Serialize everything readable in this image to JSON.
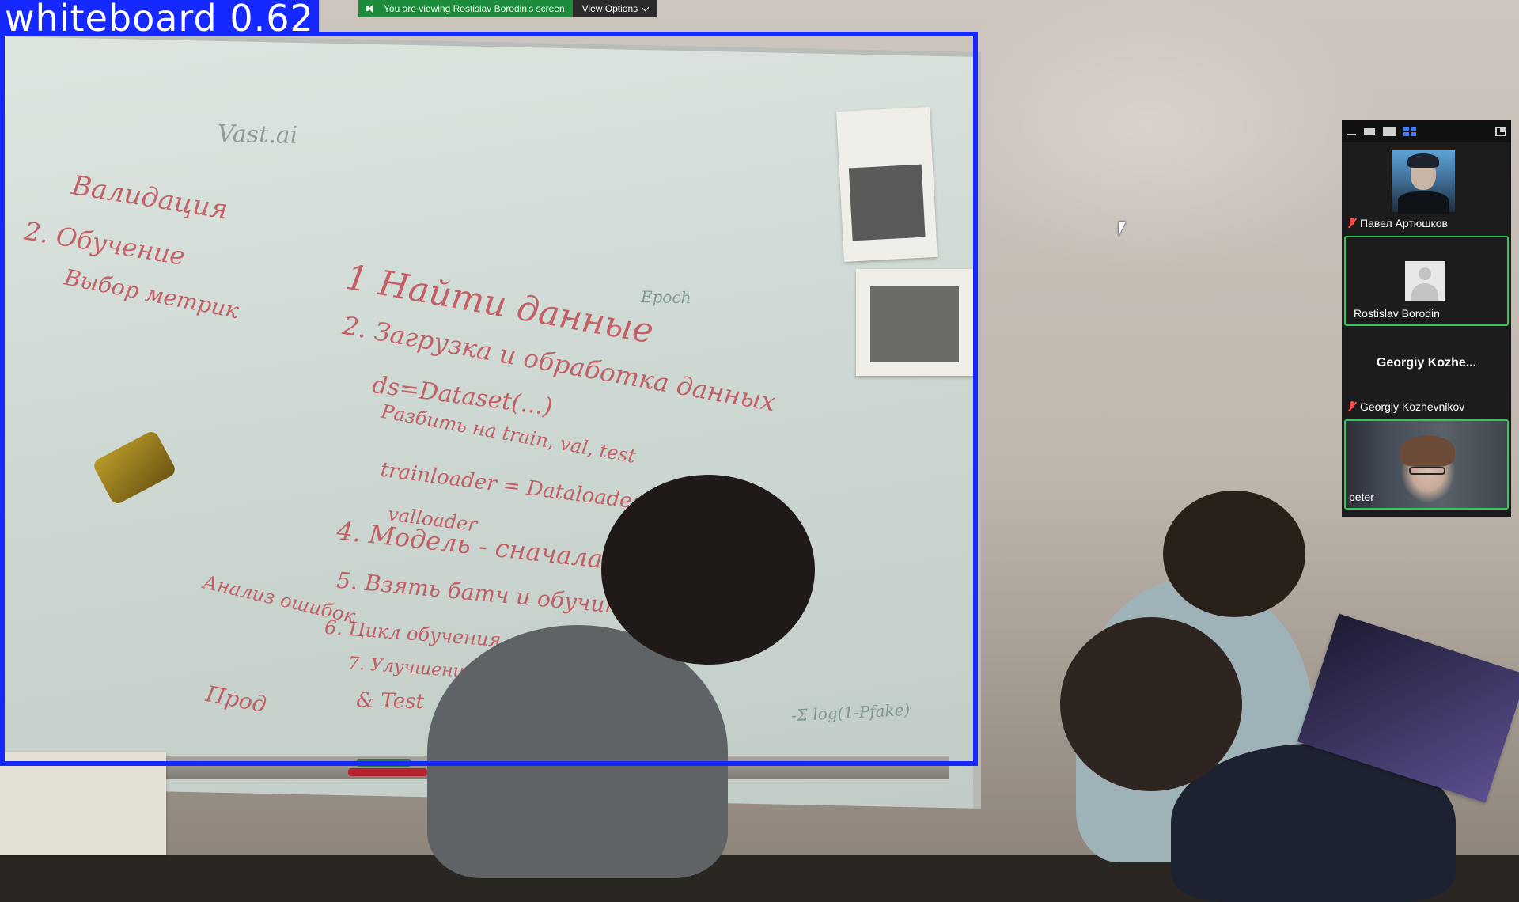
{
  "overlay": {
    "label": "whiteboard 0.62",
    "box_color": "#1428ff"
  },
  "share_banner": {
    "status_text": "You are viewing Rostislav Borodin's screen",
    "view_options_label": "View Options",
    "status_color": "#1c8c3c"
  },
  "panel": {
    "toolbar_icons": [
      "minimize-icon",
      "strip-view-icon",
      "speaker-view-icon",
      "gallery-view-icon",
      "exit-panel-icon"
    ],
    "participants": [
      {
        "name": "Павел Артюшков",
        "muted": true,
        "type": "avatar-photo"
      },
      {
        "name": "Rostislav Borodin",
        "muted": false,
        "type": "default-avatar",
        "active": true
      },
      {
        "display_name": "Georgiy Kozhe...",
        "name": "Georgiy Kozhevnikov",
        "muted": true,
        "type": "name-only"
      },
      {
        "name": "peter",
        "muted": false,
        "type": "video",
        "active": true
      }
    ]
  },
  "whiteboard_text": {
    "vast": "Vast.ai",
    "left_1": "Валидация",
    "left_2": "2. Обучение",
    "left_3": "Выбор метрик",
    "item_1": "1  Найти данные",
    "item_2": "2. Загрузка и обработка данных",
    "item_2a": "ds=Dataset(...)",
    "item_3": "Разбить на train, val, test",
    "item_3a": "trainloader = Dataloader",
    "item_3b": "valloader",
    "item_4": "4. Модель - сначала бейз",
    "item_5": "5. Взять батч и обучить",
    "item_6": "6. Цикл обучения",
    "item_7": "7. Улучшение",
    "item_7a": "& Test",
    "side_1": "Анализ ошибок",
    "side_2": "Прод",
    "epoch": "Epoch",
    "formula": "-Σ log(1-Pfake)"
  }
}
